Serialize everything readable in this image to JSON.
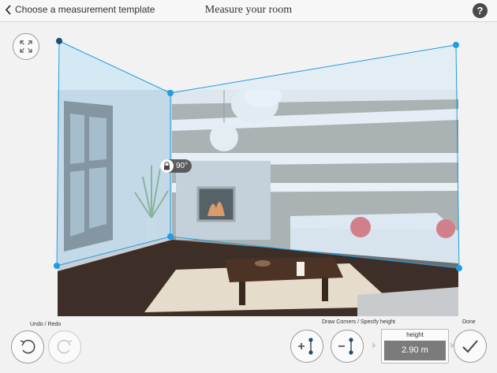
{
  "header": {
    "back_label": "Choose a measurement template",
    "title": "Measure your room",
    "help_label": "?"
  },
  "room": {
    "corner_angle": "90°"
  },
  "toolbar": {
    "undo_redo_label": "Undo / Redo",
    "draw_label": "Draw Corners / Specify height",
    "done_label": "Done",
    "height_label": "height",
    "height_value": "2.90 m",
    "redo_enabled": false
  },
  "colors": {
    "accent": "#1f9de0",
    "active_handle": "#1d4e75",
    "overlay_fill": "#cde9f8"
  }
}
